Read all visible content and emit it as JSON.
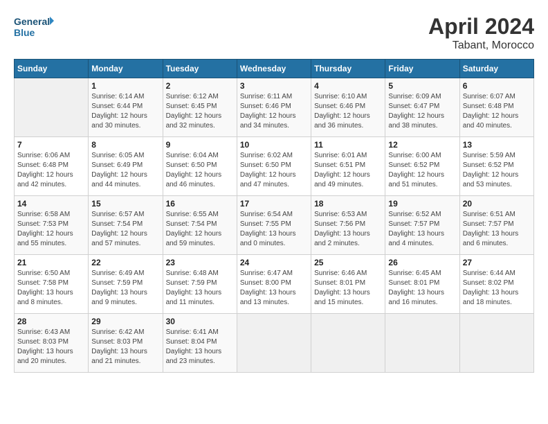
{
  "header": {
    "logo_line1": "General",
    "logo_line2": "Blue",
    "month_title": "April 2024",
    "subtitle": "Tabant, Morocco"
  },
  "weekdays": [
    "Sunday",
    "Monday",
    "Tuesday",
    "Wednesday",
    "Thursday",
    "Friday",
    "Saturday"
  ],
  "weeks": [
    [
      {
        "day": "",
        "empty": true
      },
      {
        "day": "1",
        "sunrise": "Sunrise: 6:14 AM",
        "sunset": "Sunset: 6:44 PM",
        "daylight": "Daylight: 12 hours and 30 minutes."
      },
      {
        "day": "2",
        "sunrise": "Sunrise: 6:12 AM",
        "sunset": "Sunset: 6:45 PM",
        "daylight": "Daylight: 12 hours and 32 minutes."
      },
      {
        "day": "3",
        "sunrise": "Sunrise: 6:11 AM",
        "sunset": "Sunset: 6:46 PM",
        "daylight": "Daylight: 12 hours and 34 minutes."
      },
      {
        "day": "4",
        "sunrise": "Sunrise: 6:10 AM",
        "sunset": "Sunset: 6:46 PM",
        "daylight": "Daylight: 12 hours and 36 minutes."
      },
      {
        "day": "5",
        "sunrise": "Sunrise: 6:09 AM",
        "sunset": "Sunset: 6:47 PM",
        "daylight": "Daylight: 12 hours and 38 minutes."
      },
      {
        "day": "6",
        "sunrise": "Sunrise: 6:07 AM",
        "sunset": "Sunset: 6:48 PM",
        "daylight": "Daylight: 12 hours and 40 minutes."
      }
    ],
    [
      {
        "day": "7",
        "sunrise": "Sunrise: 6:06 AM",
        "sunset": "Sunset: 6:48 PM",
        "daylight": "Daylight: 12 hours and 42 minutes."
      },
      {
        "day": "8",
        "sunrise": "Sunrise: 6:05 AM",
        "sunset": "Sunset: 6:49 PM",
        "daylight": "Daylight: 12 hours and 44 minutes."
      },
      {
        "day": "9",
        "sunrise": "Sunrise: 6:04 AM",
        "sunset": "Sunset: 6:50 PM",
        "daylight": "Daylight: 12 hours and 46 minutes."
      },
      {
        "day": "10",
        "sunrise": "Sunrise: 6:02 AM",
        "sunset": "Sunset: 6:50 PM",
        "daylight": "Daylight: 12 hours and 47 minutes."
      },
      {
        "day": "11",
        "sunrise": "Sunrise: 6:01 AM",
        "sunset": "Sunset: 6:51 PM",
        "daylight": "Daylight: 12 hours and 49 minutes."
      },
      {
        "day": "12",
        "sunrise": "Sunrise: 6:00 AM",
        "sunset": "Sunset: 6:52 PM",
        "daylight": "Daylight: 12 hours and 51 minutes."
      },
      {
        "day": "13",
        "sunrise": "Sunrise: 5:59 AM",
        "sunset": "Sunset: 6:52 PM",
        "daylight": "Daylight: 12 hours and 53 minutes."
      }
    ],
    [
      {
        "day": "14",
        "sunrise": "Sunrise: 6:58 AM",
        "sunset": "Sunset: 7:53 PM",
        "daylight": "Daylight: 12 hours and 55 minutes."
      },
      {
        "day": "15",
        "sunrise": "Sunrise: 6:57 AM",
        "sunset": "Sunset: 7:54 PM",
        "daylight": "Daylight: 12 hours and 57 minutes."
      },
      {
        "day": "16",
        "sunrise": "Sunrise: 6:55 AM",
        "sunset": "Sunset: 7:54 PM",
        "daylight": "Daylight: 12 hours and 59 minutes."
      },
      {
        "day": "17",
        "sunrise": "Sunrise: 6:54 AM",
        "sunset": "Sunset: 7:55 PM",
        "daylight": "Daylight: 13 hours and 0 minutes."
      },
      {
        "day": "18",
        "sunrise": "Sunrise: 6:53 AM",
        "sunset": "Sunset: 7:56 PM",
        "daylight": "Daylight: 13 hours and 2 minutes."
      },
      {
        "day": "19",
        "sunrise": "Sunrise: 6:52 AM",
        "sunset": "Sunset: 7:57 PM",
        "daylight": "Daylight: 13 hours and 4 minutes."
      },
      {
        "day": "20",
        "sunrise": "Sunrise: 6:51 AM",
        "sunset": "Sunset: 7:57 PM",
        "daylight": "Daylight: 13 hours and 6 minutes."
      }
    ],
    [
      {
        "day": "21",
        "sunrise": "Sunrise: 6:50 AM",
        "sunset": "Sunset: 7:58 PM",
        "daylight": "Daylight: 13 hours and 8 minutes."
      },
      {
        "day": "22",
        "sunrise": "Sunrise: 6:49 AM",
        "sunset": "Sunset: 7:59 PM",
        "daylight": "Daylight: 13 hours and 9 minutes."
      },
      {
        "day": "23",
        "sunrise": "Sunrise: 6:48 AM",
        "sunset": "Sunset: 7:59 PM",
        "daylight": "Daylight: 13 hours and 11 minutes."
      },
      {
        "day": "24",
        "sunrise": "Sunrise: 6:47 AM",
        "sunset": "Sunset: 8:00 PM",
        "daylight": "Daylight: 13 hours and 13 minutes."
      },
      {
        "day": "25",
        "sunrise": "Sunrise: 6:46 AM",
        "sunset": "Sunset: 8:01 PM",
        "daylight": "Daylight: 13 hours and 15 minutes."
      },
      {
        "day": "26",
        "sunrise": "Sunrise: 6:45 AM",
        "sunset": "Sunset: 8:01 PM",
        "daylight": "Daylight: 13 hours and 16 minutes."
      },
      {
        "day": "27",
        "sunrise": "Sunrise: 6:44 AM",
        "sunset": "Sunset: 8:02 PM",
        "daylight": "Daylight: 13 hours and 18 minutes."
      }
    ],
    [
      {
        "day": "28",
        "sunrise": "Sunrise: 6:43 AM",
        "sunset": "Sunset: 8:03 PM",
        "daylight": "Daylight: 13 hours and 20 minutes."
      },
      {
        "day": "29",
        "sunrise": "Sunrise: 6:42 AM",
        "sunset": "Sunset: 8:03 PM",
        "daylight": "Daylight: 13 hours and 21 minutes."
      },
      {
        "day": "30",
        "sunrise": "Sunrise: 6:41 AM",
        "sunset": "Sunset: 8:04 PM",
        "daylight": "Daylight: 13 hours and 23 minutes."
      },
      {
        "day": "",
        "empty": true
      },
      {
        "day": "",
        "empty": true
      },
      {
        "day": "",
        "empty": true
      },
      {
        "day": "",
        "empty": true
      }
    ]
  ]
}
